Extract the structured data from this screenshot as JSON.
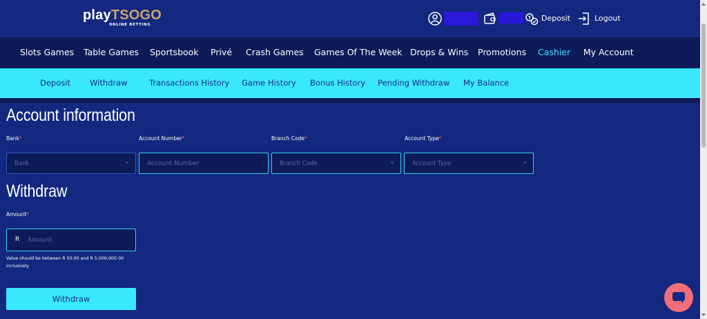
{
  "brand": {
    "play": "play",
    "tsogo": "TSOGO",
    "subtitle": "ONLINE BETTING"
  },
  "header": {
    "icons": [
      "user-icon",
      "wallet-icon",
      "deposit-icon",
      "logout-icon"
    ],
    "deposit_label": "Deposit",
    "logout_label": "Logout"
  },
  "main_nav": {
    "items": [
      {
        "label": "Slots Games"
      },
      {
        "label": "Table Games"
      },
      {
        "label": "Sportsbook"
      },
      {
        "label": "Privé"
      },
      {
        "label": "Crash Games"
      },
      {
        "label": "Games Of The Week"
      },
      {
        "label": "Drops & Wins"
      },
      {
        "label": "Promotions"
      },
      {
        "label": "Cashier",
        "active": true
      },
      {
        "label": "My Account"
      }
    ]
  },
  "sub_nav": {
    "items": [
      {
        "label": "Deposit"
      },
      {
        "label": "Withdraw"
      },
      {
        "label": "Transactions History"
      },
      {
        "label": "Game History"
      },
      {
        "label": "Bonus History"
      },
      {
        "label": "Pending Withdraw"
      },
      {
        "label": "My Balance"
      }
    ]
  },
  "account_info": {
    "title": "Account information",
    "bank": {
      "label": "Bank",
      "required": "*",
      "placeholder": "Bank"
    },
    "account_number": {
      "label": "Account Number",
      "required": "*",
      "placeholder": "Account Number"
    },
    "branch_code": {
      "label": "Branch Code",
      "required": "*",
      "placeholder": "Branch Code"
    },
    "account_type": {
      "label": "Account Type",
      "required": "*",
      "placeholder": "Account Type"
    }
  },
  "withdraw": {
    "title": "Withdraw",
    "amount": {
      "label": "Amount",
      "required": "*",
      "currency": "R",
      "placeholder": "Amount"
    },
    "hint": "Value should be between R 50.00 and R 5,000,000.00 inclusively",
    "button": "Withdraw"
  },
  "chat": {
    "icon": "chat-icon"
  },
  "colors": {
    "background": "#13287e",
    "nav_dark": "#0d1b58",
    "accent": "#3ae8fd",
    "active_nav": "#3fe6ff",
    "logo_gold": "#c9a671",
    "required": "#ff5d5d",
    "chat": "#f06e7a"
  }
}
